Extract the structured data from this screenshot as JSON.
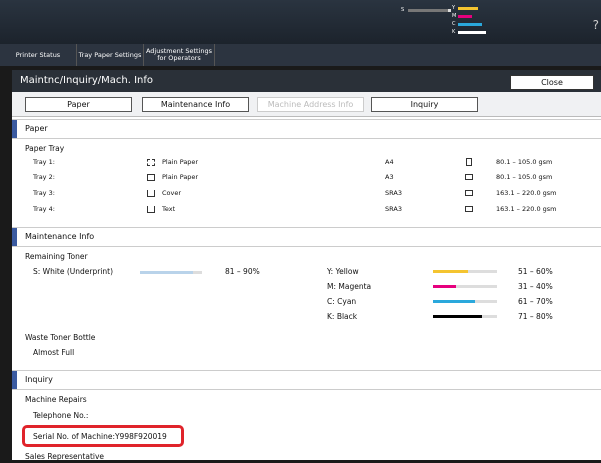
{
  "top_toner_labels": {
    "s": "S",
    "y": "Y",
    "m": "M",
    "c": "C",
    "k": "K"
  },
  "help_label": "?",
  "header_tabs": [
    "Printer Status",
    "Tray Paper Settings",
    "Adjustment Settings for Operators"
  ],
  "window": {
    "title": "Maintnc/Inquiry/Mach. Info",
    "close_label": "Close"
  },
  "sub_tabs": [
    "Paper",
    "Maintenance Info",
    "Machine Address Info",
    "Inquiry"
  ],
  "paper": {
    "section_label": "Paper",
    "tray_heading": "Paper Tray",
    "trays": [
      {
        "name": "Tray 1:",
        "type": "Plain Paper",
        "size": "A4",
        "weight": "80.1 – 105.0 gsm"
      },
      {
        "name": "Tray 2:",
        "type": "Plain Paper",
        "size": "A3",
        "weight": "80.1 – 105.0 gsm"
      },
      {
        "name": "Tray 3:",
        "type": "Cover",
        "size": "SRA3",
        "weight": "163.1 – 220.0 gsm"
      },
      {
        "name": "Tray 4:",
        "type": "Text",
        "size": "SRA3",
        "weight": "163.1 – 220.0 gsm"
      }
    ]
  },
  "maintenance": {
    "section_label": "Maintenance Info",
    "remaining_toner_label": "Remaining Toner",
    "special": {
      "label": "S: White (Underprint)",
      "range": "81 – 90%",
      "level": 0.85,
      "color": "#b9d3ea"
    },
    "toners": [
      {
        "label": "Y: Yellow",
        "range": "51 – 60%",
        "level": 0.55,
        "color": "#f4c430"
      },
      {
        "label": "M: Magenta",
        "range": "31 – 40%",
        "level": 0.36,
        "color": "#e6007e"
      },
      {
        "label": "C: Cyan",
        "range": "61 – 70%",
        "level": 0.66,
        "color": "#2aa8dc"
      },
      {
        "label": "K: Black",
        "range": "71 – 80%",
        "level": 0.76,
        "color": "#000000"
      }
    ],
    "waste_label": "Waste Toner Bottle",
    "waste_status": "Almost Full"
  },
  "inquiry": {
    "section_label": "Inquiry",
    "repairs_label": "Machine Repairs",
    "telephone_label": "Telephone No.:",
    "serial_label": "Serial No. of Machine:Y998F920019",
    "sales_label": "Sales Representative"
  }
}
